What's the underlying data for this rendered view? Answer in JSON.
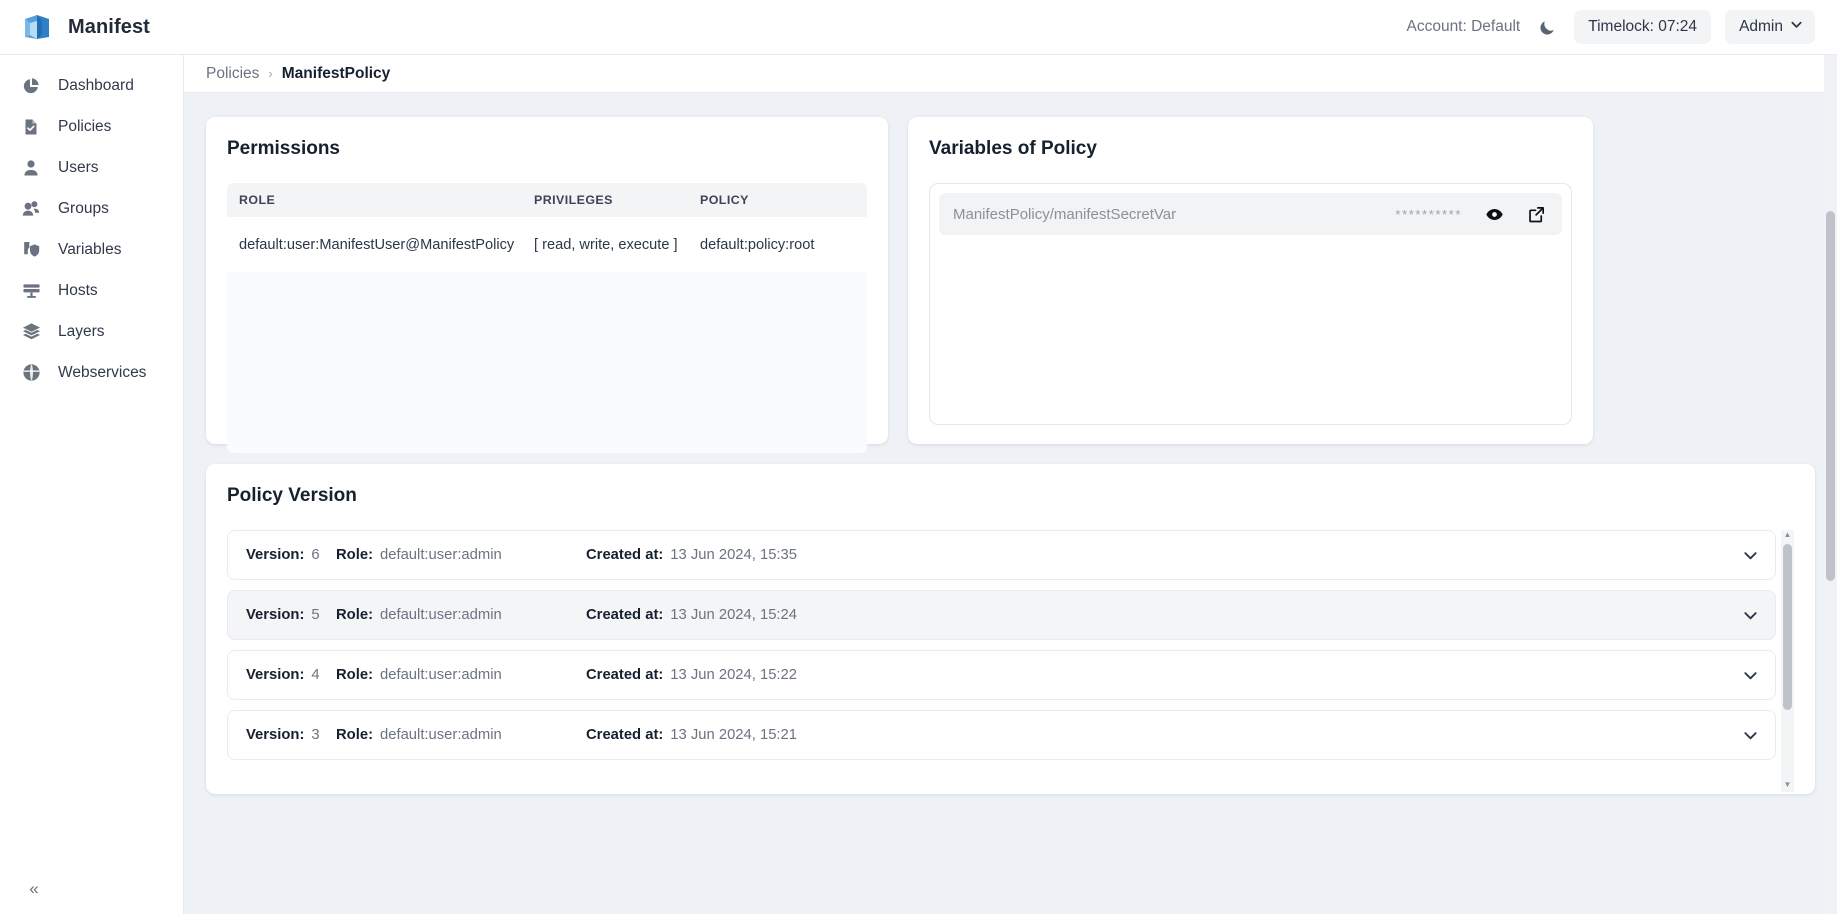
{
  "header": {
    "brand": "Manifest",
    "logo_icon": "manifest-cube-logo",
    "account": "Account: Default",
    "theme_toggle_icon": "moon-icon",
    "timelock": "Timelock: 07:24",
    "admin": "Admin",
    "admin_chevron_icon": "chevron-down-icon",
    "accent_color": "#3b8fd4"
  },
  "sidebar": {
    "items": [
      {
        "label": "Dashboard",
        "icon": "pie-chart-icon"
      },
      {
        "label": "Policies",
        "icon": "document-check-icon"
      },
      {
        "label": "Users",
        "icon": "user-icon"
      },
      {
        "label": "Groups",
        "icon": "users-group-icon"
      },
      {
        "label": "Variables",
        "icon": "shield-lock-icon"
      },
      {
        "label": "Hosts",
        "icon": "monitor-icon"
      },
      {
        "label": "Layers",
        "icon": "layers-icon"
      },
      {
        "label": "Webservices",
        "icon": "globe-icon"
      }
    ],
    "collapse_icon": "double-chevron-left-icon",
    "collapse_label": "«"
  },
  "breadcrumb": {
    "parent": "Policies",
    "separator": "›",
    "current": "ManifestPolicy"
  },
  "permissions": {
    "title": "Permissions",
    "columns": [
      "ROLE",
      "PRIVILEGES",
      "POLICY"
    ],
    "rows": [
      {
        "role": "default:user:ManifestUser@ManifestPolicy",
        "privileges": "[ read, write, execute ]",
        "policy": "default:policy:root"
      }
    ]
  },
  "variables": {
    "title": "Variables of Policy",
    "rows": [
      {
        "name": "ManifestPolicy/manifestSecretVar",
        "masked_value": "**********",
        "reveal_icon": "eye-icon",
        "open_icon": "external-link-icon"
      }
    ]
  },
  "policy_version": {
    "title": "Policy Version",
    "labels": {
      "version": "Version:",
      "role": "Role:",
      "created_at": "Created at:"
    },
    "expand_icon": "chevron-down-icon",
    "items": [
      {
        "version": "6",
        "role": "default:user:admin",
        "created_at": "13 Jun 2024, 15:35",
        "selected": false
      },
      {
        "version": "5",
        "role": "default:user:admin",
        "created_at": "13 Jun 2024, 15:24",
        "selected": true
      },
      {
        "version": "4",
        "role": "default:user:admin",
        "created_at": "13 Jun 2024, 15:22",
        "selected": false
      },
      {
        "version": "3",
        "role": "default:user:admin",
        "created_at": "13 Jun 2024, 15:21",
        "selected": false
      }
    ],
    "scroll_up_icon": "triangle-up-icon",
    "scroll_down_icon": "triangle-down-icon",
    "scroll_up_glyph": "▲",
    "scroll_down_glyph": "▼"
  }
}
